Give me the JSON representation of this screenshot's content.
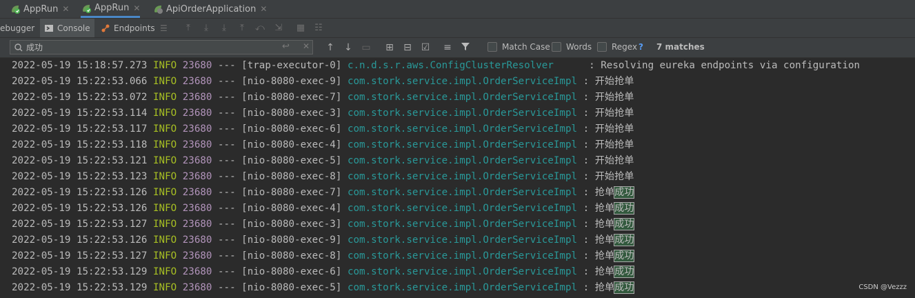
{
  "tabs": [
    {
      "label": "AppRun",
      "active": false
    },
    {
      "label": "AppRun",
      "active": true
    },
    {
      "label": "ApiOrderApplication",
      "active": false
    }
  ],
  "toolbar": {
    "debugger_label": "ebugger",
    "console_label": "Console",
    "endpoints_label": "Endpoints"
  },
  "find": {
    "query": "成功",
    "match_case_label": "Match Case",
    "words_label": "Words",
    "regex_label": "Regex",
    "help_label": "?",
    "matches_label": "7 matches"
  },
  "log": [
    {
      "ts": "2022-05-19 15:18:57.273",
      "level": "INFO",
      "pid": "23680",
      "sep": "---",
      "thread": "[trap-executor-0]",
      "logger": "c.n.d.s.r.aws.ConfigClusterResolver     ",
      "msg_pre": ": Resolving eureka endpoints via configuration",
      "msg_hl": ""
    },
    {
      "ts": "2022-05-19 15:22:53.066",
      "level": "INFO",
      "pid": "23680",
      "sep": "---",
      "thread": "[nio-8080-exec-9]",
      "logger": "com.stork.service.impl.OrderServiceImpl",
      "msg_pre": ": 开始抢单",
      "msg_hl": ""
    },
    {
      "ts": "2022-05-19 15:22:53.072",
      "level": "INFO",
      "pid": "23680",
      "sep": "---",
      "thread": "[nio-8080-exec-7]",
      "logger": "com.stork.service.impl.OrderServiceImpl",
      "msg_pre": ": 开始抢单",
      "msg_hl": ""
    },
    {
      "ts": "2022-05-19 15:22:53.114",
      "level": "INFO",
      "pid": "23680",
      "sep": "---",
      "thread": "[nio-8080-exec-3]",
      "logger": "com.stork.service.impl.OrderServiceImpl",
      "msg_pre": ": 开始抢单",
      "msg_hl": ""
    },
    {
      "ts": "2022-05-19 15:22:53.117",
      "level": "INFO",
      "pid": "23680",
      "sep": "---",
      "thread": "[nio-8080-exec-6]",
      "logger": "com.stork.service.impl.OrderServiceImpl",
      "msg_pre": ": 开始抢单",
      "msg_hl": ""
    },
    {
      "ts": "2022-05-19 15:22:53.118",
      "level": "INFO",
      "pid": "23680",
      "sep": "---",
      "thread": "[nio-8080-exec-4]",
      "logger": "com.stork.service.impl.OrderServiceImpl",
      "msg_pre": ": 开始抢单",
      "msg_hl": ""
    },
    {
      "ts": "2022-05-19 15:22:53.121",
      "level": "INFO",
      "pid": "23680",
      "sep": "---",
      "thread": "[nio-8080-exec-5]",
      "logger": "com.stork.service.impl.OrderServiceImpl",
      "msg_pre": ": 开始抢单",
      "msg_hl": ""
    },
    {
      "ts": "2022-05-19 15:22:53.123",
      "level": "INFO",
      "pid": "23680",
      "sep": "---",
      "thread": "[nio-8080-exec-8]",
      "logger": "com.stork.service.impl.OrderServiceImpl",
      "msg_pre": ": 开始抢单",
      "msg_hl": ""
    },
    {
      "ts": "2022-05-19 15:22:53.126",
      "level": "INFO",
      "pid": "23680",
      "sep": "---",
      "thread": "[nio-8080-exec-7]",
      "logger": "com.stork.service.impl.OrderServiceImpl",
      "msg_pre": ": 抢单",
      "msg_hl": "成功"
    },
    {
      "ts": "2022-05-19 15:22:53.126",
      "level": "INFO",
      "pid": "23680",
      "sep": "---",
      "thread": "[nio-8080-exec-4]",
      "logger": "com.stork.service.impl.OrderServiceImpl",
      "msg_pre": ": 抢单",
      "msg_hl": "成功"
    },
    {
      "ts": "2022-05-19 15:22:53.127",
      "level": "INFO",
      "pid": "23680",
      "sep": "---",
      "thread": "[nio-8080-exec-3]",
      "logger": "com.stork.service.impl.OrderServiceImpl",
      "msg_pre": ": 抢单",
      "msg_hl": "成功"
    },
    {
      "ts": "2022-05-19 15:22:53.126",
      "level": "INFO",
      "pid": "23680",
      "sep": "---",
      "thread": "[nio-8080-exec-9]",
      "logger": "com.stork.service.impl.OrderServiceImpl",
      "msg_pre": ": 抢单",
      "msg_hl": "成功"
    },
    {
      "ts": "2022-05-19 15:22:53.127",
      "level": "INFO",
      "pid": "23680",
      "sep": "---",
      "thread": "[nio-8080-exec-8]",
      "logger": "com.stork.service.impl.OrderServiceImpl",
      "msg_pre": ": 抢单",
      "msg_hl": "成功"
    },
    {
      "ts": "2022-05-19 15:22:53.129",
      "level": "INFO",
      "pid": "23680",
      "sep": "---",
      "thread": "[nio-8080-exec-6]",
      "logger": "com.stork.service.impl.OrderServiceImpl",
      "msg_pre": ": 抢单",
      "msg_hl": "成功"
    },
    {
      "ts": "2022-05-19 15:22:53.129",
      "level": "INFO",
      "pid": "23680",
      "sep": "---",
      "thread": "[nio-8080-exec-5]",
      "logger": "com.stork.service.impl.OrderServiceImpl",
      "msg_pre": ": 抢单",
      "msg_hl": "成功"
    }
  ],
  "watermark": "CSDN @Vezzz",
  "colors": {
    "level": "#a8c023",
    "pid": "#b294bb",
    "logger": "#299999",
    "highlight": "#32593d",
    "tab_underline": "#4a88c7"
  }
}
